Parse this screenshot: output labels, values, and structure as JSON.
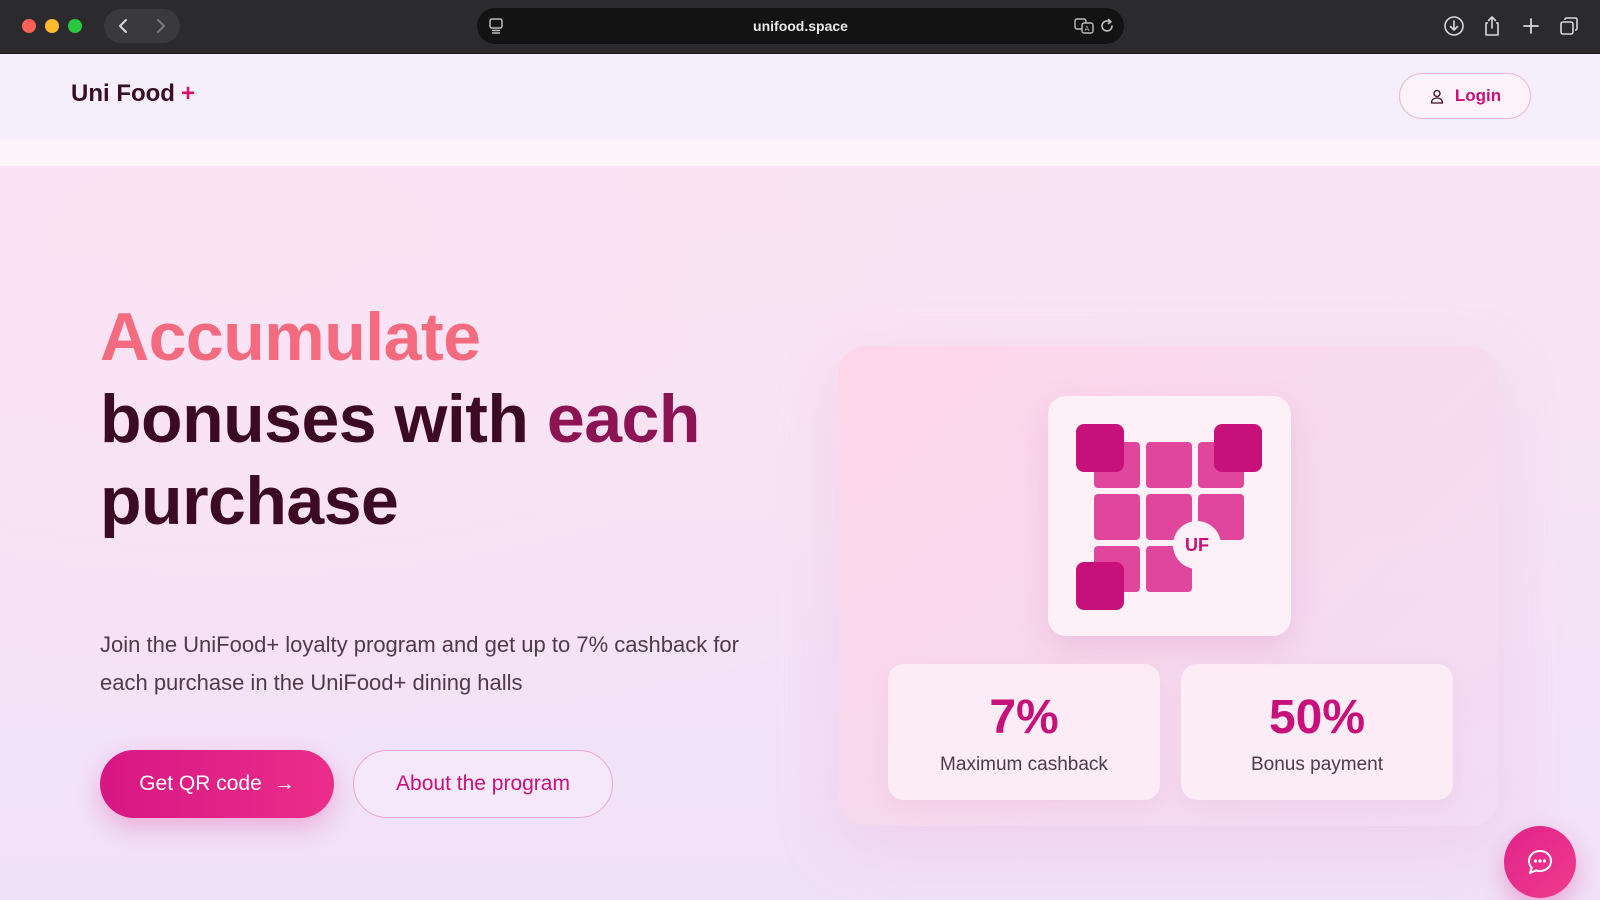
{
  "browser": {
    "url": "unifood.space",
    "icons": {
      "back": "chevron-left-icon",
      "forward": "chevron-right-icon",
      "reader": "reader-icon",
      "translate": "translate-icon",
      "reload": "reload-icon",
      "download": "download-icon",
      "share": "share-icon",
      "new_tab": "plus-icon",
      "tabs": "tabs-icon"
    }
  },
  "header": {
    "logo_text": "Uni Food",
    "logo_plus": "+",
    "login_label": "Login",
    "login_icon": "user-icon"
  },
  "hero": {
    "headline_line1": "Accumulate",
    "headline_line2a": "bonuses with",
    "headline_line2b": "each",
    "headline_line3": "purchase",
    "subtitle": "Join the UniFood+ loyalty program and get up to 7% cashback for each purchase in the UniFood+ dining halls",
    "primary_button": "Get QR code",
    "primary_arrow": "→",
    "secondary_button": "About the program"
  },
  "visual": {
    "badge_text": "UF",
    "stats": [
      {
        "value": "7%",
        "label": "Maximum cashback"
      },
      {
        "value": "50%",
        "label": "Bonus payment"
      }
    ]
  },
  "colors": {
    "brand": "#c8107a",
    "accent_gradient_start": "#d61784",
    "headline_coral": "#f46a7f",
    "headline_dark": "#3c0a22"
  },
  "chat": {
    "icon": "chat-bubble-icon"
  }
}
